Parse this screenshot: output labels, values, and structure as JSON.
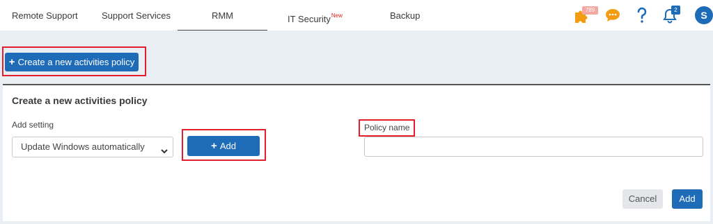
{
  "nav": {
    "tabs": [
      {
        "label": "Remote Support"
      },
      {
        "label": "Support Services"
      },
      {
        "label": "RMM"
      },
      {
        "label": "IT Security",
        "badge": "New"
      },
      {
        "label": "Backup"
      }
    ],
    "active_tab": "RMM",
    "puzzle_count": "789",
    "notification_count": "2",
    "avatar_initial": "S",
    "icons": [
      "puzzle-icon",
      "chat-icon",
      "help-icon",
      "bell-icon"
    ]
  },
  "toolbar": {
    "create_label": "Create a new activities policy"
  },
  "form": {
    "title": "Create a new activities policy",
    "add_setting_label": "Add setting",
    "setting_selected": "Update Windows automatically",
    "add_setting_button": "Add",
    "policy_name_label": "Policy name",
    "policy_name_value": "",
    "cancel_label": "Cancel",
    "submit_label": "Add"
  },
  "colors": {
    "primary": "#1e6bb8",
    "highlight": "#e41e2b",
    "accent_orange": "#f39c12",
    "background": "#e9edf4"
  }
}
